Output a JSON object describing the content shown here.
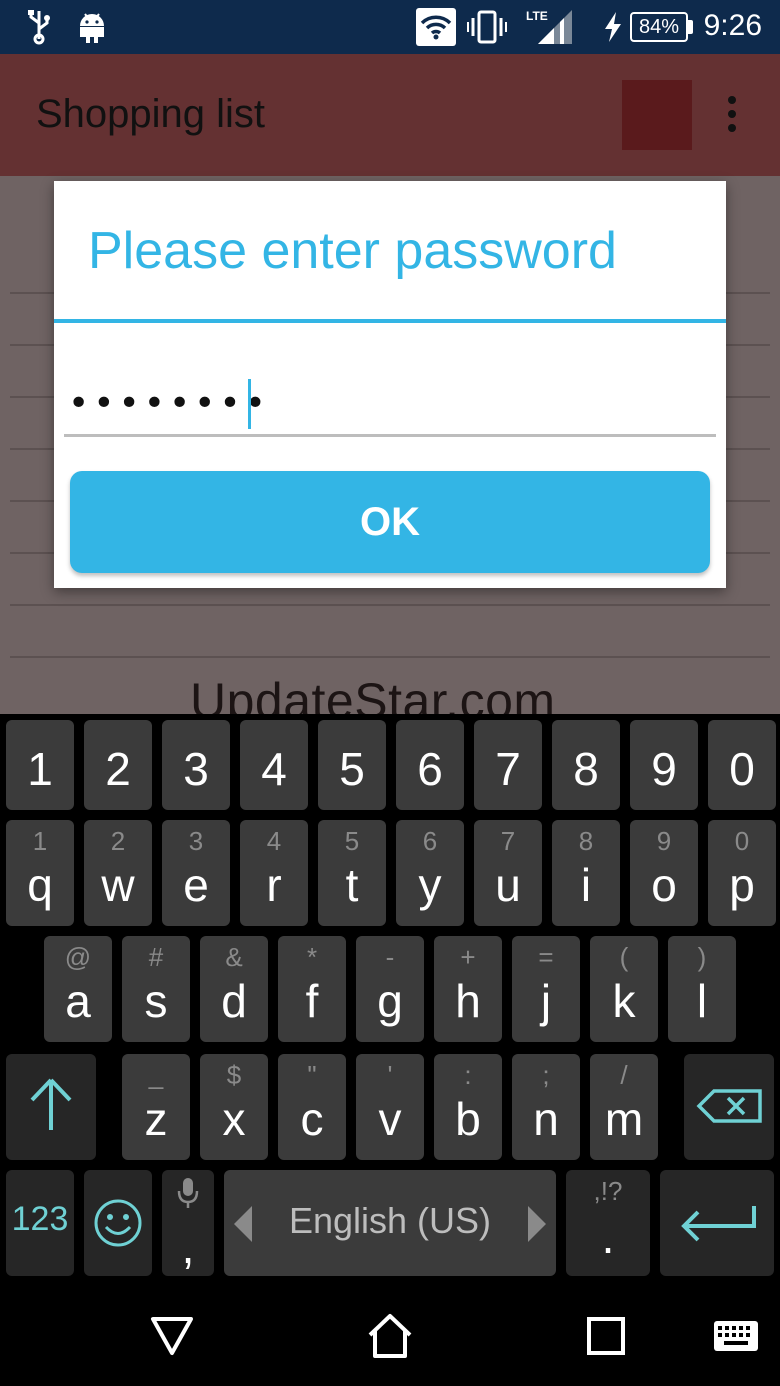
{
  "status_bar": {
    "battery": "84%",
    "time": "9:26",
    "network": "LTE",
    "icons": [
      "usb-icon",
      "android-icon",
      "wifi-icon",
      "vibrate-icon",
      "signal-icon",
      "charging-icon",
      "battery-icon"
    ]
  },
  "app_bar": {
    "title": "Shopping list",
    "swatch_color": "#5a1a1c"
  },
  "background": {
    "watermark": "UpdateStar.com"
  },
  "dialog": {
    "title": "Please enter password",
    "password_mask": "••••••••",
    "ok_label": "OK",
    "accent_color": "#33b5e5"
  },
  "keyboard": {
    "number_row": [
      "1",
      "2",
      "3",
      "4",
      "5",
      "6",
      "7",
      "8",
      "9",
      "0"
    ],
    "row1": [
      {
        "main": "q",
        "hint": "1"
      },
      {
        "main": "w",
        "hint": "2"
      },
      {
        "main": "e",
        "hint": "3"
      },
      {
        "main": "r",
        "hint": "4"
      },
      {
        "main": "t",
        "hint": "5"
      },
      {
        "main": "y",
        "hint": "6"
      },
      {
        "main": "u",
        "hint": "7"
      },
      {
        "main": "i",
        "hint": "8"
      },
      {
        "main": "o",
        "hint": "9"
      },
      {
        "main": "p",
        "hint": "0"
      }
    ],
    "row2": [
      {
        "main": "a",
        "hint": "@"
      },
      {
        "main": "s",
        "hint": "#"
      },
      {
        "main": "d",
        "hint": "&"
      },
      {
        "main": "f",
        "hint": "*"
      },
      {
        "main": "g",
        "hint": "-"
      },
      {
        "main": "h",
        "hint": "+"
      },
      {
        "main": "j",
        "hint": "="
      },
      {
        "main": "k",
        "hint": "("
      },
      {
        "main": "l",
        "hint": ")"
      }
    ],
    "row3": [
      {
        "main": "z",
        "hint": "_"
      },
      {
        "main": "x",
        "hint": "$"
      },
      {
        "main": "c",
        "hint": "\""
      },
      {
        "main": "v",
        "hint": "'"
      },
      {
        "main": "b",
        "hint": ":"
      },
      {
        "main": "n",
        "hint": ";"
      },
      {
        "main": "m",
        "hint": "/"
      }
    ],
    "symbols_label": "123",
    "comma_label": ",",
    "space_label": "English (US)",
    "period_hint": ",!?",
    "period_label": "."
  }
}
